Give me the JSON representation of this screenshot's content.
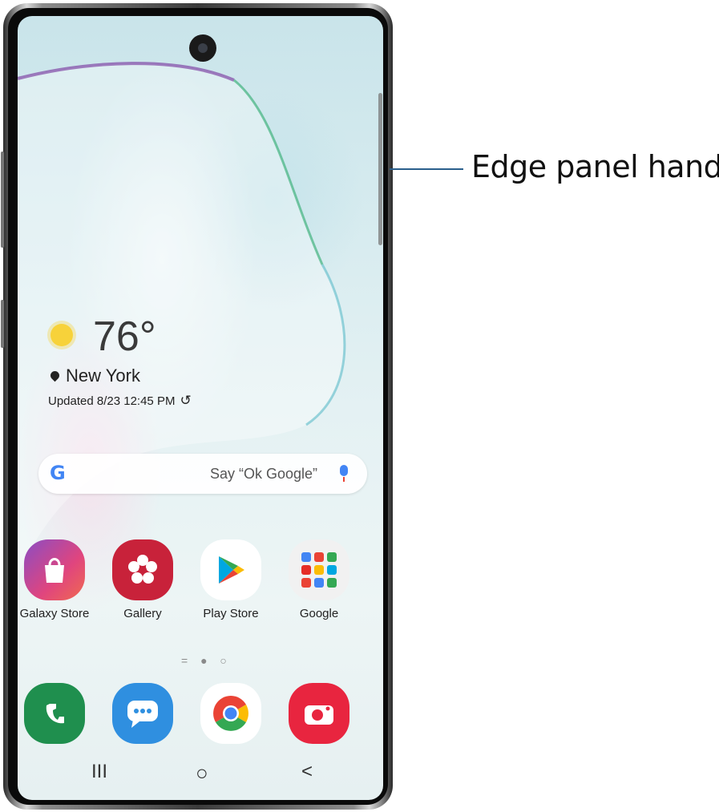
{
  "callout": {
    "label": "Edge panel handle"
  },
  "weather": {
    "temperature": "76°",
    "location": "New York",
    "updated": "Updated 8/23 12:45 PM",
    "refresh_glyph": "↺"
  },
  "search": {
    "logo": "G",
    "hint": "Say “Ok Google”"
  },
  "apps_row": [
    {
      "label": "Galaxy Store",
      "icon": "galaxy-store-icon",
      "color": "#e0457e"
    },
    {
      "label": "Gallery",
      "icon": "gallery-icon",
      "color": "#c8223a"
    },
    {
      "label": "Play Store",
      "icon": "play-store-icon",
      "color": "#ffffff"
    },
    {
      "label": "Google",
      "icon": "google-folder-icon",
      "color": "#f4f4f4"
    }
  ],
  "dock": [
    {
      "icon": "phone-icon",
      "color": "#1f8f4e"
    },
    {
      "icon": "messages-icon",
      "color": "#2f8fe0"
    },
    {
      "icon": "chrome-icon",
      "color": "#ffffff"
    },
    {
      "icon": "camera-icon",
      "color": "#e8253f"
    }
  ],
  "page_indicator": "= ● ○",
  "navbar": {
    "recents": "III",
    "home": "○",
    "back": "<"
  }
}
